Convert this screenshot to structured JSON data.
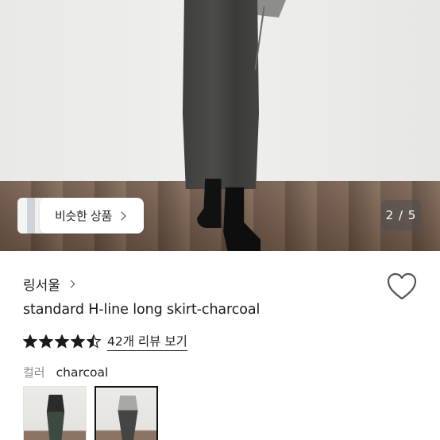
{
  "gallery": {
    "similar_label": "비슷한 상품",
    "counter": "2 / 5",
    "current": 2,
    "total": 5
  },
  "product": {
    "shop_name": "링서울",
    "title": "standard H-line long skirt-charcoal",
    "rating": 4.5,
    "review_link": "42개 리뷰 보기",
    "color_key": "컬러",
    "color_value": "charcoal"
  },
  "colors": {
    "star": "#1a1a1a",
    "heart_stroke": "#555555",
    "counter_bg": "#505050"
  },
  "icons": [
    "chevron-right-icon",
    "heart-icon",
    "star-icon"
  ]
}
